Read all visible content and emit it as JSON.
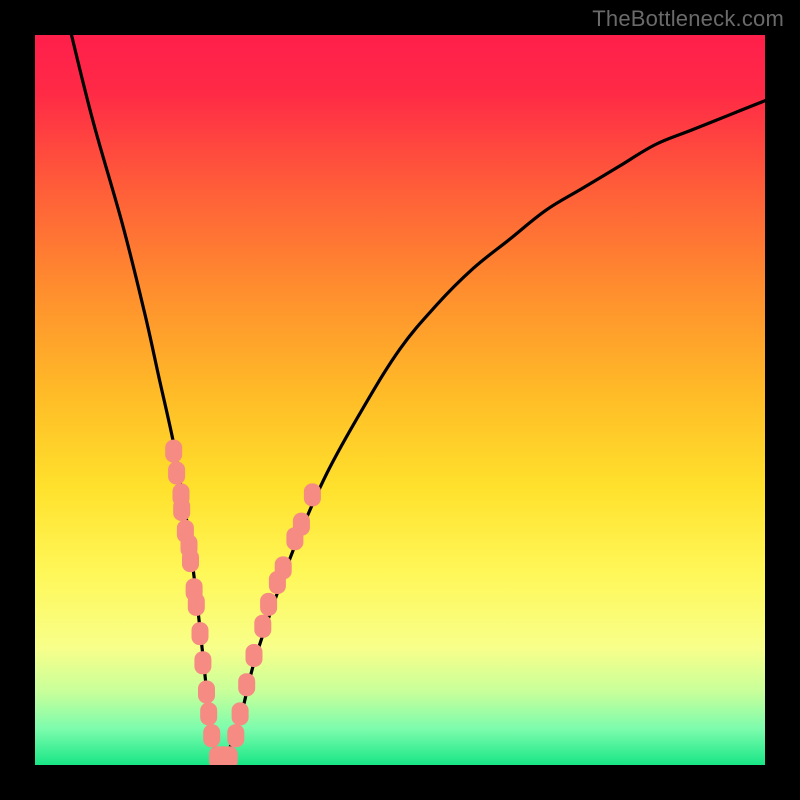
{
  "watermark": {
    "text": "TheBottleneck.com"
  },
  "gradient": {
    "stops": [
      {
        "offset": 0.0,
        "color": "#ff1f4b"
      },
      {
        "offset": 0.08,
        "color": "#ff2a46"
      },
      {
        "offset": 0.2,
        "color": "#ff5a3a"
      },
      {
        "offset": 0.35,
        "color": "#ff8e2e"
      },
      {
        "offset": 0.5,
        "color": "#ffbe27"
      },
      {
        "offset": 0.62,
        "color": "#ffe12c"
      },
      {
        "offset": 0.74,
        "color": "#fff85a"
      },
      {
        "offset": 0.84,
        "color": "#f8ff8a"
      },
      {
        "offset": 0.9,
        "color": "#c7ff9a"
      },
      {
        "offset": 0.95,
        "color": "#7dfcad"
      },
      {
        "offset": 1.0,
        "color": "#18e686"
      }
    ]
  },
  "chart_data": {
    "type": "line",
    "title": "",
    "xlabel": "",
    "ylabel": "",
    "xlim": [
      0,
      100
    ],
    "ylim": [
      0,
      100
    ],
    "series": [
      {
        "name": "bottleneck-curve",
        "x": [
          5,
          8,
          12,
          15,
          17,
          19,
          20,
          21,
          22,
          23,
          24,
          25,
          26,
          28,
          30,
          33,
          36,
          40,
          45,
          50,
          55,
          60,
          65,
          70,
          75,
          80,
          85,
          90,
          95,
          100
        ],
        "y": [
          100,
          88,
          74,
          62,
          53,
          44,
          38,
          32,
          24,
          15,
          6,
          1,
          1,
          6,
          14,
          23,
          31,
          40,
          49,
          57,
          63,
          68,
          72,
          76,
          79,
          82,
          85,
          87,
          89,
          91
        ]
      }
    ],
    "scatter": {
      "name": "highlighted-points",
      "color": "#f58b82",
      "points": [
        {
          "x": 19.0,
          "y": 43
        },
        {
          "x": 19.4,
          "y": 40
        },
        {
          "x": 20.0,
          "y": 37
        },
        {
          "x": 20.1,
          "y": 35
        },
        {
          "x": 20.6,
          "y": 32
        },
        {
          "x": 21.1,
          "y": 30
        },
        {
          "x": 21.3,
          "y": 28
        },
        {
          "x": 21.8,
          "y": 24
        },
        {
          "x": 22.1,
          "y": 22
        },
        {
          "x": 22.6,
          "y": 18
        },
        {
          "x": 23.0,
          "y": 14
        },
        {
          "x": 23.5,
          "y": 10
        },
        {
          "x": 23.8,
          "y": 7
        },
        {
          "x": 24.2,
          "y": 4
        },
        {
          "x": 25.0,
          "y": 1
        },
        {
          "x": 25.8,
          "y": 1
        },
        {
          "x": 26.6,
          "y": 1
        },
        {
          "x": 27.5,
          "y": 4
        },
        {
          "x": 28.1,
          "y": 7
        },
        {
          "x": 29.0,
          "y": 11
        },
        {
          "x": 30.0,
          "y": 15
        },
        {
          "x": 31.2,
          "y": 19
        },
        {
          "x": 32.0,
          "y": 22
        },
        {
          "x": 33.2,
          "y": 25
        },
        {
          "x": 34.0,
          "y": 27
        },
        {
          "x": 35.6,
          "y": 31
        },
        {
          "x": 36.5,
          "y": 33
        },
        {
          "x": 38.0,
          "y": 37
        }
      ]
    }
  }
}
